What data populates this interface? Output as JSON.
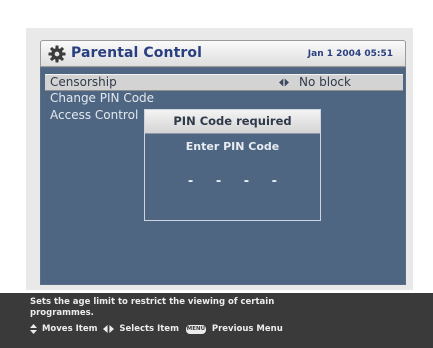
{
  "header": {
    "title": "Parental Control",
    "datetime": "Jan 1 2004 05:51",
    "icon": "gear-icon"
  },
  "menu": {
    "items": [
      {
        "label": "Censorship",
        "value": "No block",
        "selected": true
      },
      {
        "label": "Change PIN Code"
      },
      {
        "label": "Access Control"
      }
    ]
  },
  "pin_dialog": {
    "title": "PIN Code required",
    "prompt": "Enter PIN Code",
    "digits": "- - - -"
  },
  "help": {
    "description": "Sets the age limit to restrict the viewing of certain programmes.",
    "moves_label": "Moves Item",
    "selects_label": "Selects Item",
    "menu_key": "MENU",
    "previous_label": "Previous Menu"
  },
  "colors": {
    "panel_blue": "#4e6682",
    "title_blue": "#2a3f80",
    "help_bar": "#3a3a3a",
    "highlight": "#d3d3d3"
  }
}
